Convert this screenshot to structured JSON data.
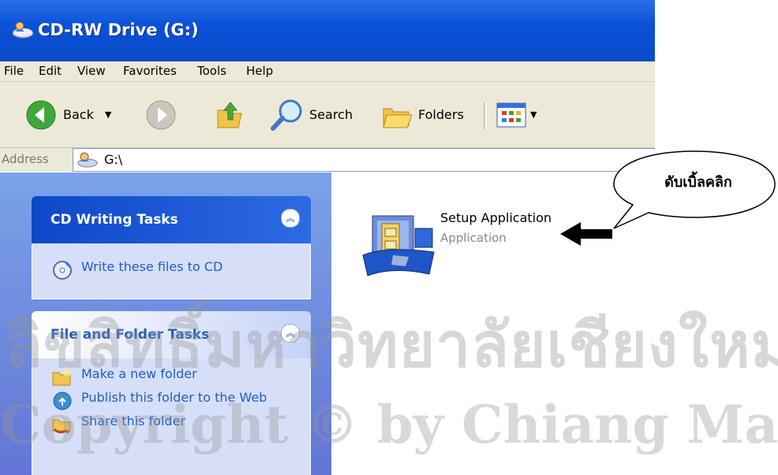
{
  "window": {
    "title": "CD-RW Drive (G:)",
    "menu": [
      "File",
      "Edit",
      "View",
      "Favorites",
      "Tools",
      "Help"
    ],
    "toolbar": {
      "back": "Back",
      "search": "Search",
      "folders": "Folders"
    },
    "address": {
      "label": "Address",
      "value": "G:\\"
    }
  },
  "task_pane": {
    "cd_writing": {
      "title": "CD Writing Tasks",
      "items": [
        {
          "label": "Write these files to CD",
          "icon": "cd-write-icon"
        }
      ]
    },
    "file_folder": {
      "title": "File and Folder Tasks",
      "items": [
        {
          "label": "Make a new folder",
          "icon": "new-folder-icon"
        },
        {
          "label": "Publish this folder to the Web",
          "icon": "publish-web-icon"
        },
        {
          "label": "Share this folder",
          "icon": "share-folder-icon"
        }
      ]
    }
  },
  "content": {
    "file": {
      "name": "Setup Application",
      "type": "Application",
      "icon": "setup-installer-icon"
    }
  },
  "annotation": {
    "callout": "ดับเบิ้ลคลิก",
    "arrow_icon": "left-arrow-icon"
  },
  "watermark": {
    "line1": "ลิขสิทธิ์มหาวิทยาลัยเชียงใหม่",
    "line2": "Copyright © by Chiang Mai University"
  },
  "colors": {
    "titlebar": "#0a52d8",
    "chrome": "#ece9d8",
    "pane": "#6f8fe0",
    "link": "#215dc6"
  }
}
